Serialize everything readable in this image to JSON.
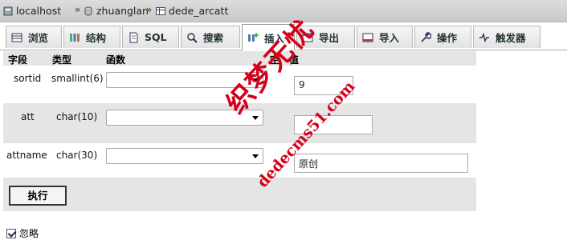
{
  "breadcrumb": {
    "server": "localhost",
    "database": "zhuanglan",
    "table": "dede_arcatt",
    "separator": "»"
  },
  "tabs": [
    {
      "label": "浏览",
      "icon": "browse-icon"
    },
    {
      "label": "结构",
      "icon": "structure-icon"
    },
    {
      "label": "SQL",
      "icon": "sql-icon"
    },
    {
      "label": "搜索",
      "icon": "search-icon"
    },
    {
      "label": "插入",
      "icon": "insert-icon",
      "active": true
    },
    {
      "label": "导出",
      "icon": "export-icon"
    },
    {
      "label": "导入",
      "icon": "import-icon"
    },
    {
      "label": "操作",
      "icon": "wrench-icon"
    },
    {
      "label": "触发器",
      "icon": "triggers-icon"
    }
  ],
  "table": {
    "headers": {
      "field": "字段",
      "type": "类型",
      "function": "函数",
      "null": "空",
      "value": "值"
    },
    "rows": [
      {
        "field": "sortid",
        "type": "smallint(6)",
        "function": "",
        "value": "9"
      },
      {
        "field": "att",
        "type": "char(10)",
        "function": "",
        "value": ""
      },
      {
        "field": "attname",
        "type": "char(30)",
        "function": "",
        "value": "原创"
      }
    ]
  },
  "actions": {
    "go_label": "执行"
  },
  "ignore": {
    "label": "忽略",
    "checked": true
  },
  "watermark": {
    "logo_text": "织梦无忧",
    "url_text": "dedecms51.com",
    "color": "#d4001a"
  },
  "colors": {
    "header_bg": "#e5e5e5",
    "row_alt_bg": "#e5e5e5",
    "crumbbar_bg": "#d2d2d2"
  }
}
